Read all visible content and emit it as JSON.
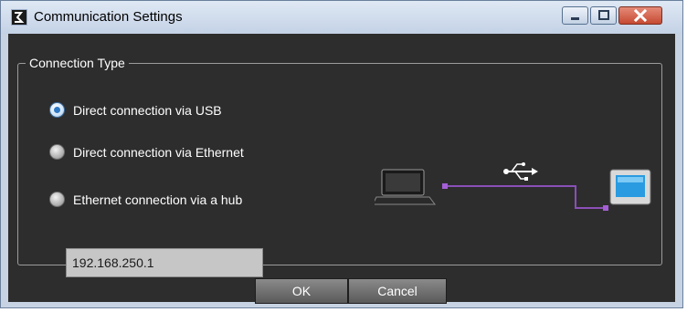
{
  "window": {
    "title": "Communication Settings",
    "icons": [
      "app-icon",
      "minimize-icon",
      "maximize-icon",
      "close-icon"
    ]
  },
  "connection_type": {
    "legend": "Connection Type",
    "options": [
      {
        "label": "Direct connection via USB",
        "checked": true
      },
      {
        "label": "Direct connection via Ethernet",
        "checked": false
      },
      {
        "label": "Ethernet connection via a hub",
        "checked": false
      }
    ],
    "ip_address": "192.168.250.1"
  },
  "diagram": {
    "icons": [
      "laptop-icon",
      "usb-icon",
      "hmi-panel-icon"
    ],
    "cable_color": "#8a4fb8"
  },
  "buttons": {
    "ok": "OK",
    "cancel": "Cancel"
  }
}
